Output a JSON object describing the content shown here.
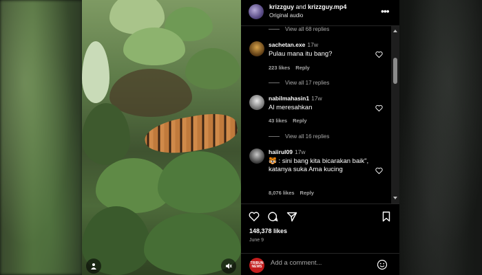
{
  "post": {
    "author": "krizzguy",
    "connector": "and",
    "coauthor": "krizzguy.mp4",
    "audio": "Original audio"
  },
  "comments": [
    {
      "view_replies": "View all 68 replies"
    },
    {
      "username": "sachetan.exe",
      "ago": "17w",
      "text": "Pulau mana itu bang?",
      "likes": "223 likes",
      "reply": "Reply",
      "view_replies": "View all 17 replies"
    },
    {
      "username": "nabilmahasin1",
      "ago": "17w",
      "text": "Al meresahkan",
      "likes": "43 likes",
      "reply": "Reply",
      "view_replies": "View all 16 replies"
    },
    {
      "username": "haiirul09",
      "ago": "17w",
      "text": "🐯 : sini bang kita bicarakan baik\", katanya suka Ama kucing",
      "likes": "8,076 likes",
      "reply": "Reply"
    }
  ],
  "footer": {
    "likes": "148,378 likes",
    "date": "June 9",
    "avatar_text": "TRIBUN NEWS",
    "add_comment_placeholder": "Add a comment..."
  },
  "icons": {
    "header_more": "more-icon",
    "heart": "heart-icon",
    "comment": "comment-icon",
    "share": "share-icon",
    "save": "bookmark-icon",
    "emoji": "emoji-icon",
    "profile": "user-icon",
    "mute": "mute-icon"
  },
  "colors": {
    "panel_bg": "#000000",
    "text_primary": "#ffffff",
    "text_secondary": "#a8a8a8",
    "avatar_red": "#c21d1d"
  }
}
